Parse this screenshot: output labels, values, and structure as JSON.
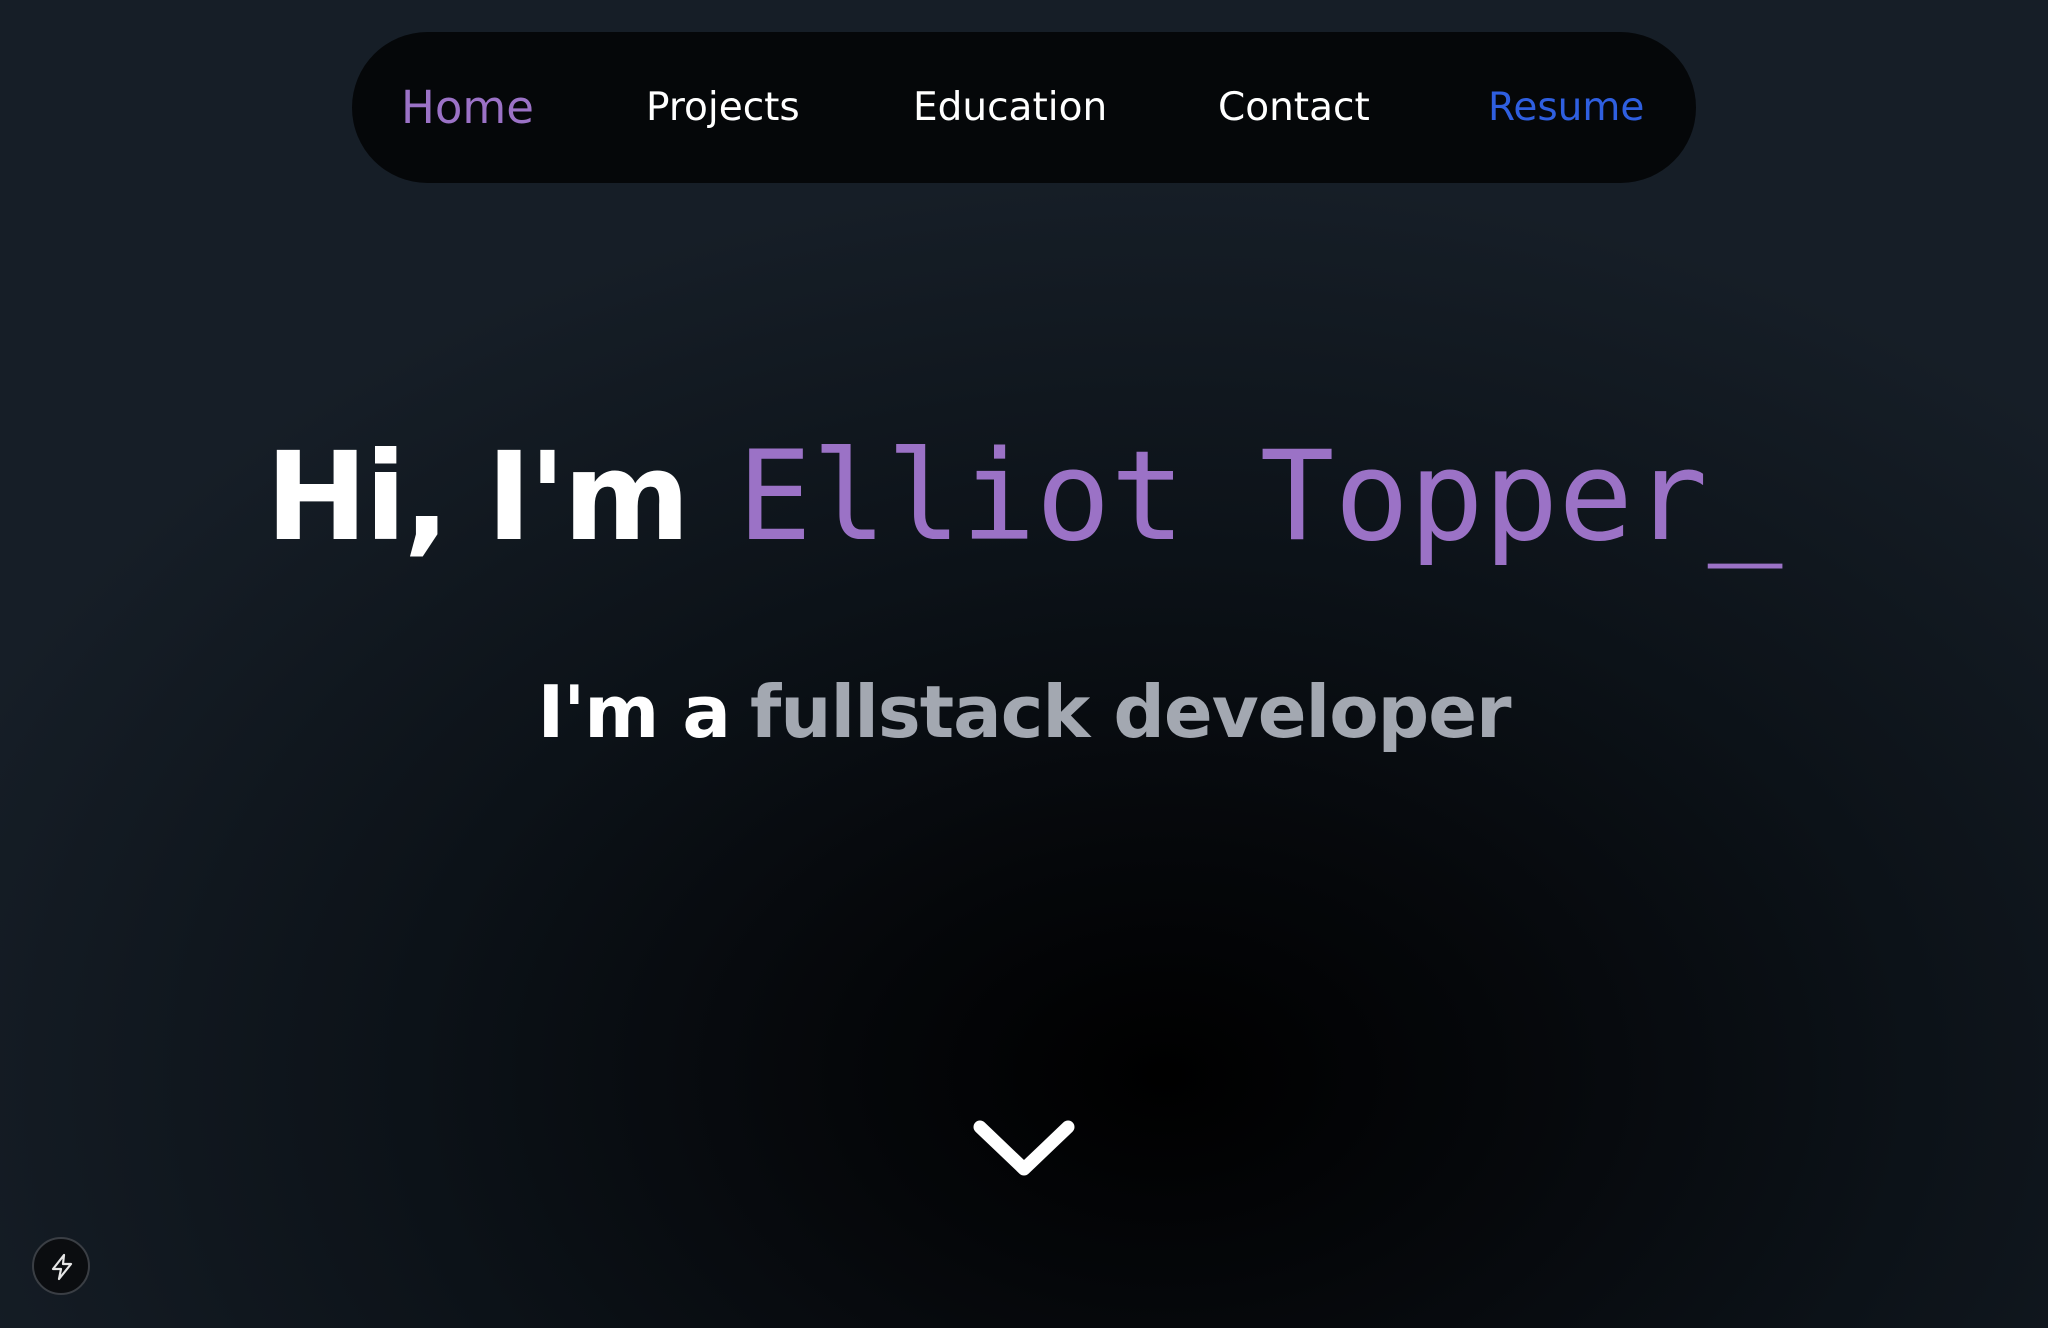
{
  "nav": {
    "items": [
      {
        "label": "Home"
      },
      {
        "label": "Projects"
      },
      {
        "label": "Education"
      },
      {
        "label": "Contact"
      },
      {
        "label": "Resume"
      }
    ]
  },
  "hero": {
    "greeting": "Hi, I'm",
    "name": "Elliot Topper",
    "cursor": "_",
    "subtitle_prefix": "I'm a",
    "subtitle_role": "fullstack developer"
  },
  "icons": {
    "scroll": "chevron-down-icon",
    "fab": "lightning-bolt-icon"
  },
  "colors": {
    "accent_purple": "#9b72c6",
    "resume_blue": "#2f5fe0",
    "subtitle_gray": "#a3a8b1",
    "text_white": "#ffffff",
    "nav_bg": "#050709"
  }
}
